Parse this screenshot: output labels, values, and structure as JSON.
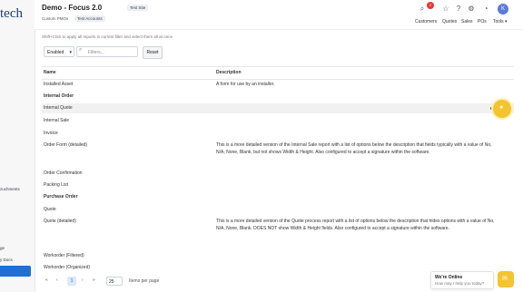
{
  "sidebar": {
    "logo": "tech",
    "items": [
      {
        "label": "zuchments"
      },
      {
        "label": "ge"
      },
      {
        "label": "y Docs"
      }
    ]
  },
  "header": {
    "title": "Demo - Focus 2.0",
    "badge": "Test Site",
    "subtitle": "Custom PMOs",
    "sub_badge": "Test Accounts",
    "notif_count": "2",
    "avatar": "K",
    "nav": [
      "Customers",
      "Quotes",
      "Sales",
      "POs",
      "Tools ▾"
    ]
  },
  "hint": "Shift+Click to apply all reports in current filter and select them all at once",
  "filters": {
    "status_value": "Enabled",
    "search_placeholder": "Filters...",
    "reset_label": "Reset"
  },
  "table": {
    "columns": [
      "Name",
      "Description"
    ],
    "rows": [
      {
        "name": "Installed Asset",
        "desc": "A form for use by an installer."
      },
      {
        "name": "Internal Order",
        "desc": ""
      },
      {
        "name": "Internal Quote",
        "desc": ""
      },
      {
        "name": "Internal Sale",
        "desc": ""
      },
      {
        "name": "Invoice",
        "desc": ""
      },
      {
        "name": "Order Form (detailed)",
        "desc": "This is a more detailed version of the Internal Sale report with a list of options below the description that fields typically with a value of No, N/A, None, Blank, but not shows Width & Height. Also configured to accept a signature within the software."
      },
      {
        "name": "Order Confirmation",
        "desc": ""
      },
      {
        "name": "Packing List",
        "desc": ""
      },
      {
        "name": "Purchase Order",
        "desc": ""
      },
      {
        "name": "Quote",
        "desc": ""
      },
      {
        "name": "Quote (detailed)",
        "desc": "This is a more detailed version of the Quote process report with a list of options below the description that hides options with a value of No, N/A, None, Blank. DOES NOT show Width & Height fields. Also configured to accept a signature within the software."
      },
      {
        "name": "Workorder (Filtered)",
        "desc": ""
      },
      {
        "name": "Workorder (Organized)",
        "desc": ""
      }
    ]
  },
  "pagination": {
    "first": "«",
    "prev": "‹",
    "current": "1",
    "next": "›",
    "last": "»",
    "per_page_value": "25",
    "per_page_label": "Items per page"
  },
  "chat": {
    "title": "We're Online",
    "subtitle": "How may I help you today?"
  },
  "icons": {
    "accent": "#f4c430",
    "active": "#1f6fd6"
  }
}
